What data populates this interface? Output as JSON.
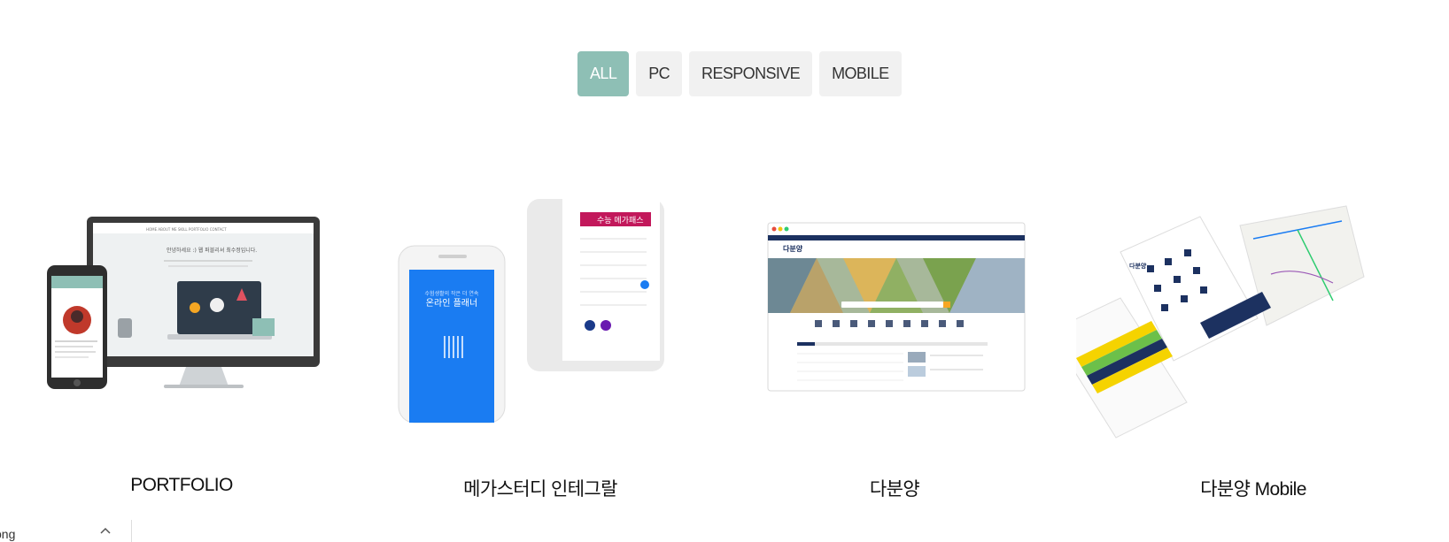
{
  "filters": {
    "items": [
      {
        "label": "ALL",
        "active": true
      },
      {
        "label": "PC",
        "active": false
      },
      {
        "label": "RESPONSIVE",
        "active": false
      },
      {
        "label": "MOBILE",
        "active": false
      }
    ]
  },
  "portfolio": {
    "items": [
      {
        "title": "PORTFOLIO",
        "thumb": {
          "top_text": "안녕하세요 :) 웹 퍼블리셔 최수정입니다.",
          "nav": [
            "HOME",
            "ABOUT ME",
            "SKILL",
            "PORTFOLIO",
            "CONTACT"
          ]
        }
      },
      {
        "title": "메가스터디 인테그랄",
        "thumb": {
          "phone_text_small": "수험생활의 작은 더 연속",
          "phone_text_big": "온라인 플래너",
          "banner_text": "수능 메가패스"
        }
      },
      {
        "title": "다분양",
        "thumb": {
          "logo": "다분양"
        }
      },
      {
        "title": "다분양 Mobile",
        "thumb": {
          "logo": "다분양"
        }
      }
    ]
  },
  "download_bar": {
    "filename": "png"
  },
  "colors": {
    "accent": "#8ebfb5",
    "tab_bg": "#f1f1f1",
    "navy": "#1c3160",
    "blue": "#1a7cf2"
  }
}
